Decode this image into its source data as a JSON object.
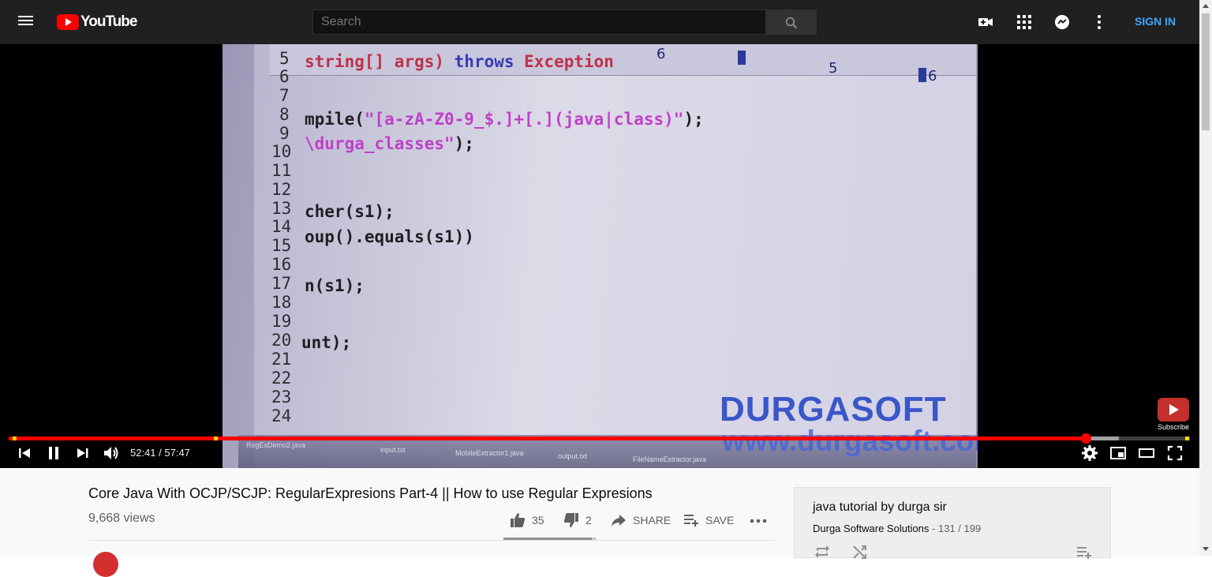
{
  "header": {
    "logo_text": "YouTube",
    "search_placeholder": "Search",
    "signin_label": "SIGN IN",
    "icons": [
      "menu-icon",
      "youtube-logo-icon",
      "search-icon",
      "create-video-icon",
      "apps-icon",
      "messages-icon",
      "more-vert-icon"
    ]
  },
  "player": {
    "video_content": {
      "line_numbers": [
        "5",
        "6",
        "7",
        "8",
        "9",
        "10",
        "11",
        "12",
        "13",
        "14",
        "15",
        "16",
        "17",
        "18",
        "19",
        "20",
        "21",
        "22",
        "23",
        "24"
      ],
      "code_lines": [
        {
          "prefix": "string[] args) ",
          "kw1": "throws",
          "kw2": " Exception"
        },
        {
          "text": "mpile(",
          "str": "\"[a-zA-Z0-9_$.]+[.](java|class)\"",
          "tail": ");"
        },
        {
          "str": "\\durga_classes\"",
          "tail": ");"
        },
        {
          "text": "cher(s1);"
        },
        {
          "text": "oup().equals(s1))"
        },
        {
          "text": "n(s1);"
        },
        {
          "text": "unt);"
        }
      ],
      "ruler_numbers": [
        "6",
        "5",
        "6"
      ],
      "watermark_line1": "DURGASOFT",
      "watermark_line2": "www.durgasoft.com",
      "taskbar_items": [
        "RegExDemo2.java",
        "input.txt",
        "MobileExtractor1.java",
        "output.txt",
        "FileNameExtractor.java"
      ]
    },
    "subscribe_label": "Subscribe",
    "current_time": "52:41",
    "duration": "57:47",
    "time_display": "52:41 / 57:47",
    "progress_fraction": 0.9116,
    "buffered_fraction": 0.94,
    "chapter_marks_fraction": [
      0.005,
      0.175,
      0.997
    ],
    "controls": [
      "previous-icon",
      "pause-icon",
      "next-icon",
      "volume-icon",
      "settings-icon",
      "miniplayer-icon",
      "theater-mode-icon",
      "fullscreen-icon"
    ]
  },
  "video_info": {
    "title": "Core Java With OCJP/SCJP: RegularExpresions Part-4 || How to use Regular Expresions",
    "views": "9,668 views",
    "likes": "35",
    "dislikes": "2",
    "share_label": "SHARE",
    "save_label": "SAVE",
    "like_ratio": 0.946
  },
  "playlist": {
    "title": "java tutorial by durga sir",
    "owner": "Durga Software Solutions",
    "separator": " - ",
    "position": "131 / 199"
  },
  "colors": {
    "masthead_bg": "#202020",
    "accent_red": "#ff0000",
    "link_blue": "#3ea6ff",
    "chapter_yellow": "#ffd600"
  }
}
